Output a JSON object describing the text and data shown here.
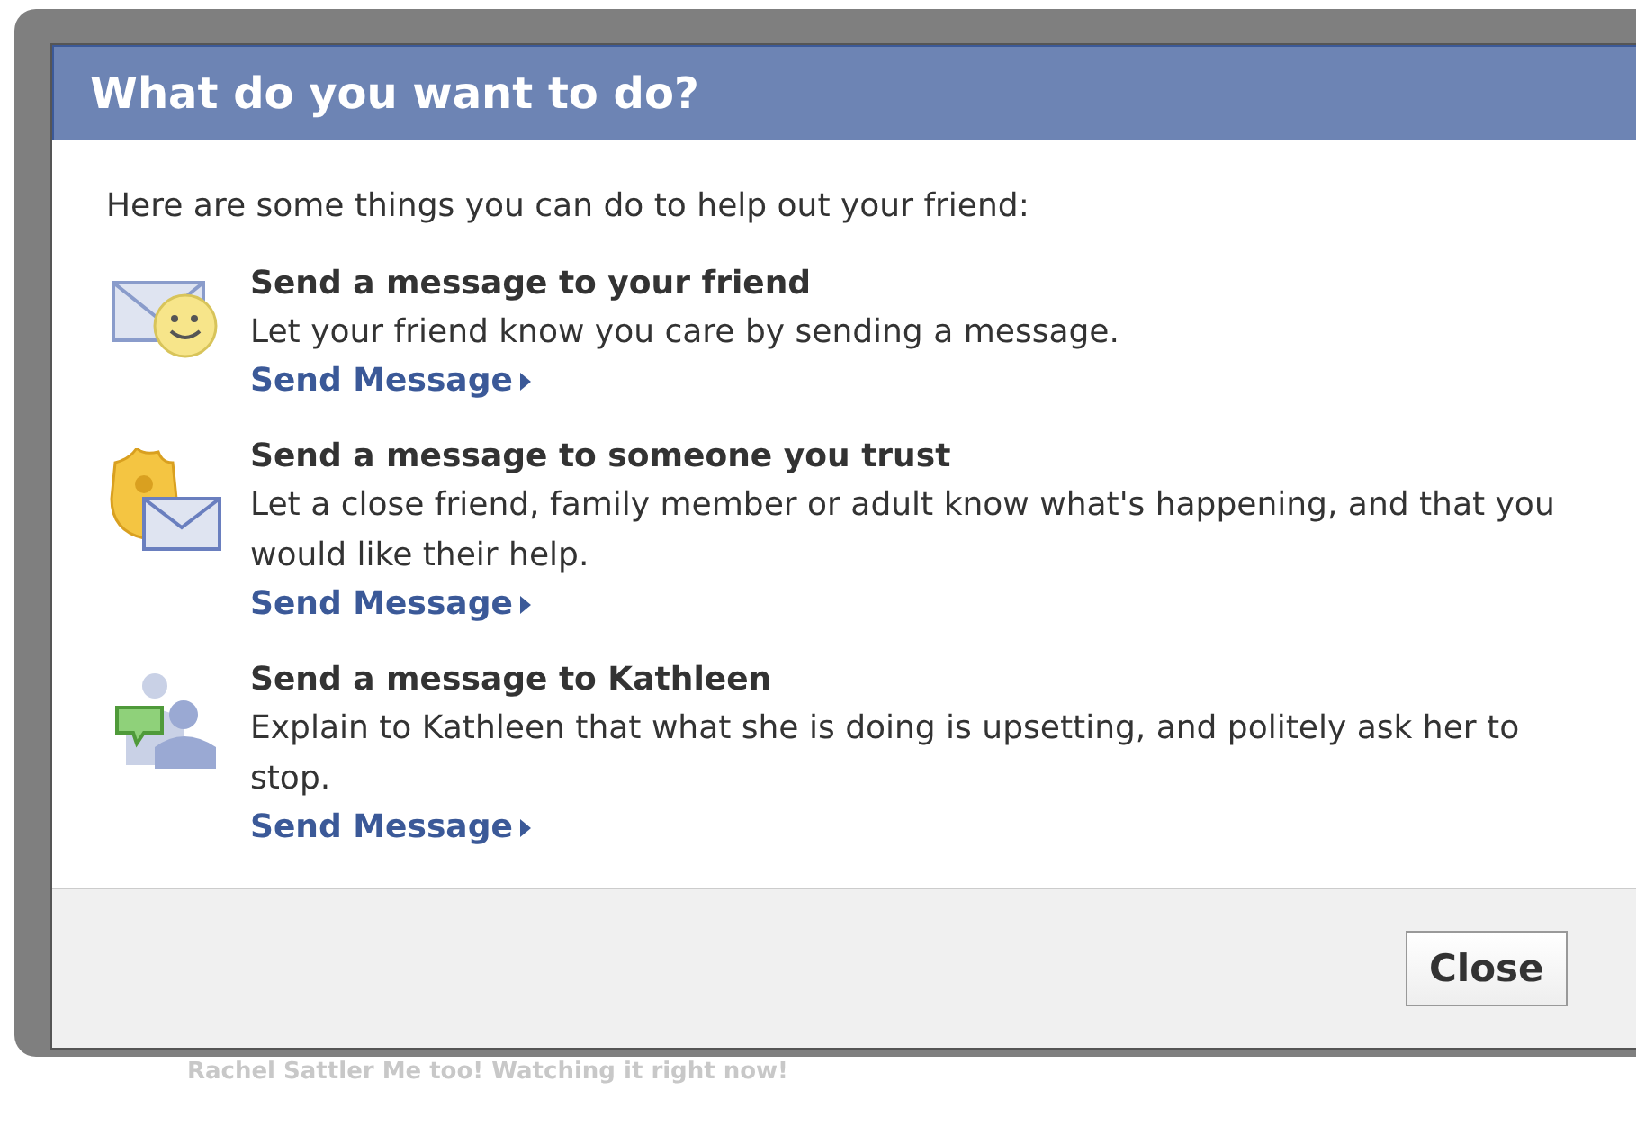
{
  "dialog": {
    "title": "What do you want to do?",
    "intro": "Here are some things you can do to help out your friend:",
    "options": [
      {
        "kind": "friend",
        "heading": "Send a message to your friend",
        "description": "Let your friend know you care by sending a message.",
        "link": "Send Message"
      },
      {
        "kind": "trusted",
        "heading": "Send a message to someone you trust",
        "description": "Let a close friend, family member or adult know what's happening, and that you would like their help.",
        "link": "Send Message"
      },
      {
        "kind": "person",
        "heading": "Send a message to Kathleen",
        "description": "Explain to Kathleen that what she is doing is upsetting, and politely ask her to stop.",
        "link": "Send Message"
      }
    ],
    "close_button": "Close"
  },
  "background_comment": "Rachel Sattler Me too! Watching it right now!"
}
